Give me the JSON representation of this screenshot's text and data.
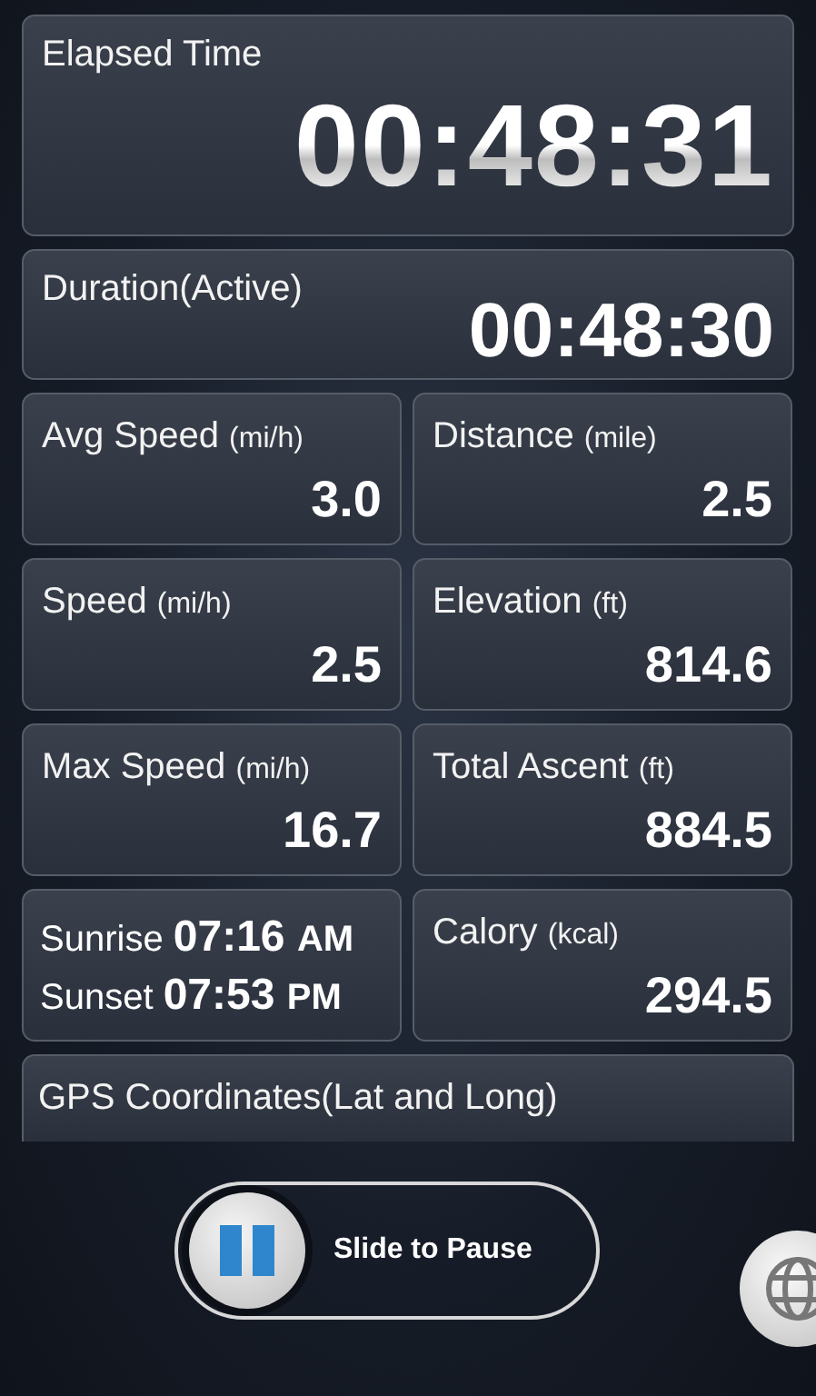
{
  "elapsed": {
    "label": "Elapsed Time",
    "value": "00:48:31"
  },
  "duration": {
    "label": "Duration(Active)",
    "value": "00:48:30"
  },
  "tiles": [
    {
      "kind": "metric",
      "label": "Avg Speed",
      "unit": "(mi/h)",
      "value": "3.0"
    },
    {
      "kind": "metric",
      "label": "Distance",
      "unit": "(mile)",
      "value": "2.5"
    },
    {
      "kind": "metric",
      "label": "Speed",
      "unit": "(mi/h)",
      "value": "2.5"
    },
    {
      "kind": "metric",
      "label": "Elevation",
      "unit": "(ft)",
      "value": "814.6"
    },
    {
      "kind": "metric",
      "label": "Max Speed",
      "unit": "(mi/h)",
      "value": "16.7"
    },
    {
      "kind": "metric",
      "label": "Total Ascent",
      "unit": "(ft)",
      "value": "884.5"
    },
    {
      "kind": "sun",
      "lines": [
        {
          "label": "Sunrise",
          "time": "07:16",
          "period": "AM"
        },
        {
          "label": "Sunset",
          "time": "07:53",
          "period": "PM"
        }
      ]
    },
    {
      "kind": "metric",
      "label": "Calory",
      "unit": "(kcal)",
      "value": "294.5"
    }
  ],
  "gps": {
    "label": "GPS Coordinates(Lat and Long)"
  },
  "slider": {
    "label": "Slide to Pause"
  }
}
